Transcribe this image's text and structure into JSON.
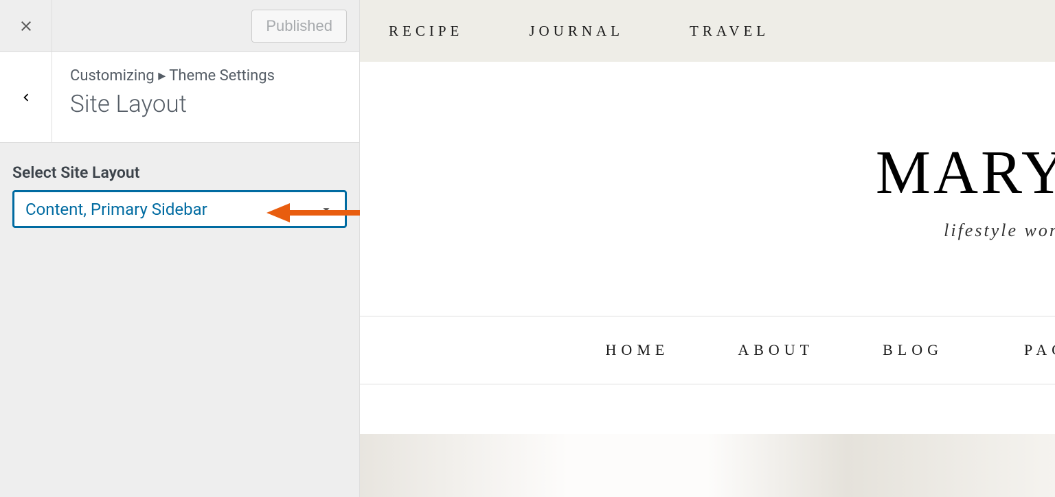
{
  "sidebar": {
    "published_label": "Published",
    "breadcrumb_root": "Customizing",
    "breadcrumb_separator": "▸",
    "breadcrumb_parent": "Theme Settings",
    "section_title": "Site Layout",
    "control_label": "Select Site Layout",
    "select_value": "Content, Primary Sidebar"
  },
  "preview": {
    "top_nav": [
      "RECIPE",
      "JOURNAL",
      "TRAVEL"
    ],
    "hero_title": "MARY",
    "hero_subtitle": "lifestyle word",
    "main_nav": [
      "HOME",
      "ABOUT",
      "BLOG",
      "PAG"
    ]
  }
}
